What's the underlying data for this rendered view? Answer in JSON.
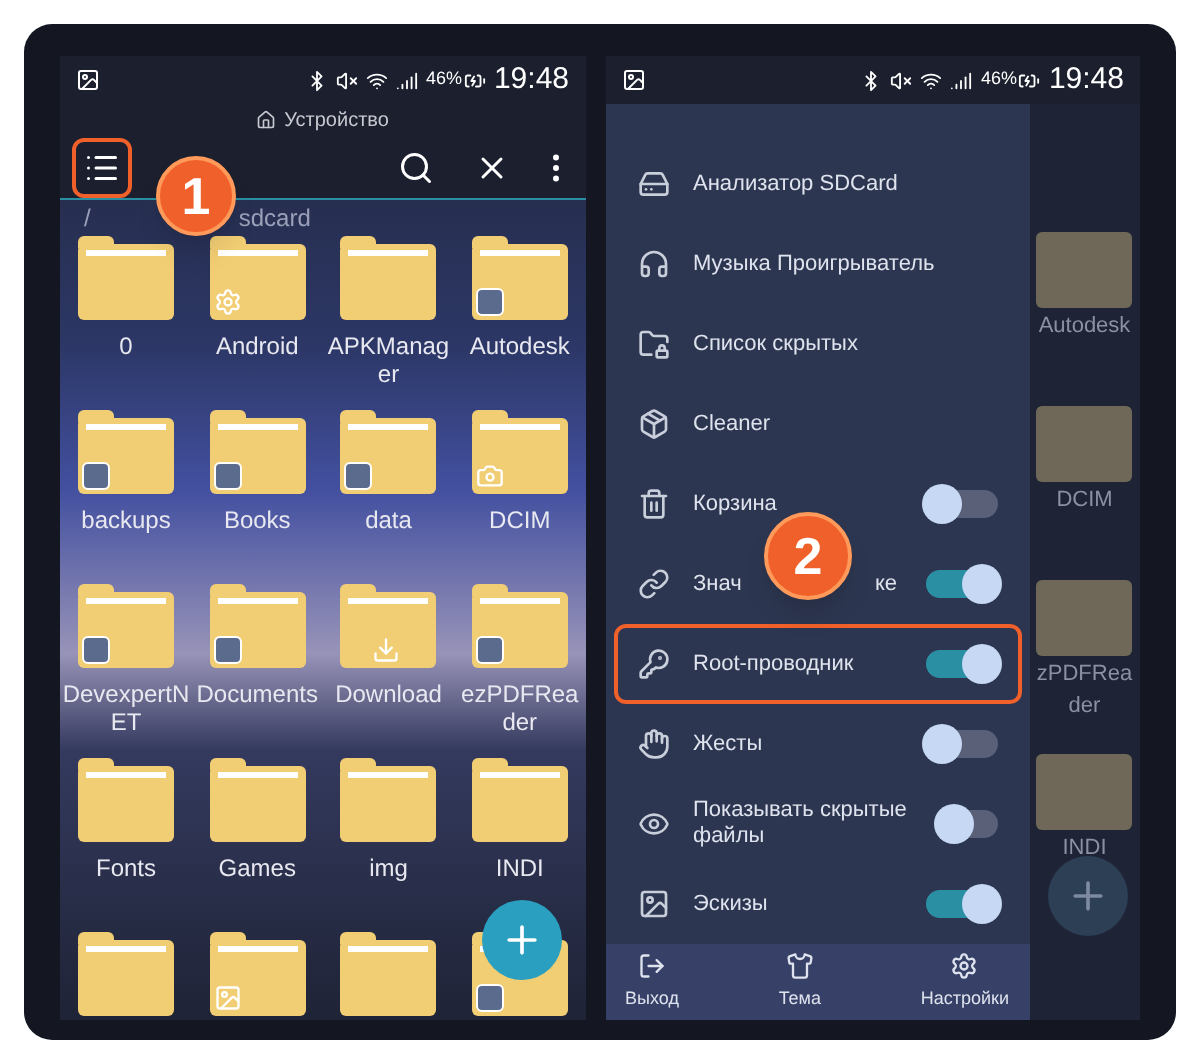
{
  "phones": [
    {
      "status": {
        "battery": "46%",
        "time": "19:48"
      },
      "breadcrumb": "Устройство",
      "path": {
        "root": "/",
        "folder": "sdcard"
      },
      "menu_highlighted": true,
      "folders": [
        {
          "kind": "labeled",
          "label": "0"
        },
        {
          "kind": "labeled",
          "label": "Android"
        },
        {
          "kind": "labeled",
          "label": "APKManager"
        },
        {
          "kind": "labeled",
          "label": "Autodesk"
        },
        {
          "kind": "labeled",
          "label": "backups"
        },
        {
          "kind": "labeled",
          "label": "Books"
        },
        {
          "kind": "labeled",
          "label": "data"
        },
        {
          "kind": "labeled",
          "label": "DCIM"
        },
        {
          "kind": "labeled",
          "label": "DevexpertNET"
        },
        {
          "kind": "labeled",
          "label": "Documents"
        },
        {
          "kind": "labeled",
          "label": "Download"
        },
        {
          "kind": "labeled",
          "label": "ezPDFReader"
        },
        {
          "kind": "labeled",
          "label": "Fonts"
        },
        {
          "kind": "labeled",
          "label": "Games"
        },
        {
          "kind": "labeled",
          "label": "img"
        },
        {
          "kind": "labeled",
          "label": "INDI"
        },
        {
          "kind": "unlabeled"
        },
        {
          "kind": "unlabeled"
        },
        {
          "kind": "unlabeled"
        },
        {
          "kind": "unlabeled"
        }
      ]
    },
    {
      "status": {
        "battery": "46%",
        "time": "19:48"
      },
      "drawer": [
        {
          "label": "Анализатор SDCard",
          "kind": "link"
        },
        {
          "label": "Музыка Проигрыватель",
          "kind": "link"
        },
        {
          "label": "Список скрытых",
          "kind": "link"
        },
        {
          "label": "Cleaner",
          "kind": "link"
        },
        {
          "label": "Корзина",
          "kind": "toggle",
          "on": false,
          "highlighted": false
        },
        {
          "label": "Знач",
          "label_end": "ке",
          "kind": "toggle",
          "on": true,
          "highlighted": false
        },
        {
          "label": "Root-проводник",
          "kind": "toggle",
          "on": true,
          "highlighted": true
        },
        {
          "label": "Жесты",
          "kind": "toggle",
          "on": false,
          "highlighted": false
        },
        {
          "label": "Показывать скрытые файлы",
          "kind": "toggle",
          "on": false,
          "highlighted": false
        },
        {
          "label": "Эскизы",
          "kind": "toggle",
          "on": true,
          "highlighted": false
        }
      ],
      "footer": [
        {
          "label": "Выход"
        },
        {
          "label": "Тема"
        },
        {
          "label": "Настройки"
        }
      ],
      "background_folders": [
        {
          "lines": [
            "Autodesk"
          ]
        },
        {
          "lines": [
            "DCIM"
          ]
        },
        {
          "lines": [
            "zPDFRea",
            "der"
          ]
        },
        {
          "lines": [
            "INDI"
          ]
        }
      ]
    }
  ],
  "annotations": [
    {
      "number": "1"
    },
    {
      "number": "2"
    }
  ]
}
